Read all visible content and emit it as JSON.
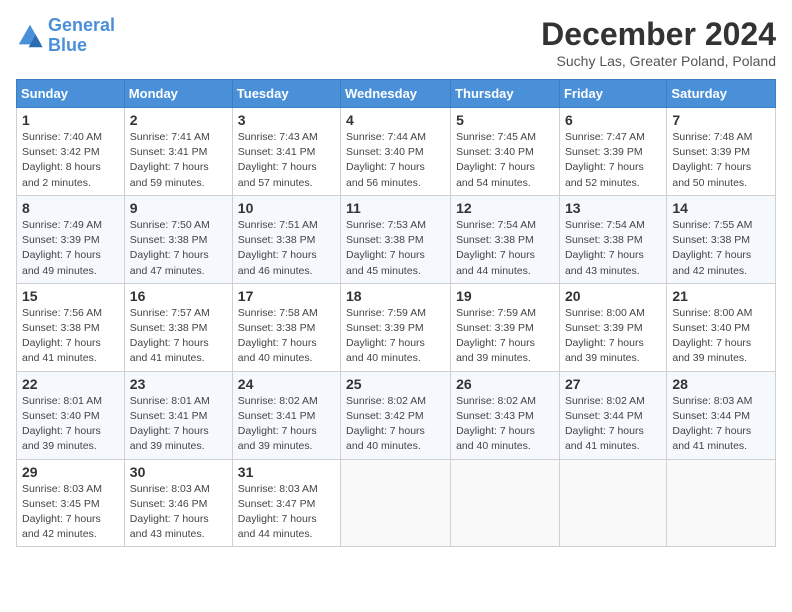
{
  "header": {
    "logo_line1": "General",
    "logo_line2": "Blue",
    "month_title": "December 2024",
    "location": "Suchy Las, Greater Poland, Poland"
  },
  "days_of_week": [
    "Sunday",
    "Monday",
    "Tuesday",
    "Wednesday",
    "Thursday",
    "Friday",
    "Saturday"
  ],
  "weeks": [
    [
      {
        "day": "1",
        "sunrise": "Sunrise: 7:40 AM",
        "sunset": "Sunset: 3:42 PM",
        "daylight": "Daylight: 8 hours and 2 minutes."
      },
      {
        "day": "2",
        "sunrise": "Sunrise: 7:41 AM",
        "sunset": "Sunset: 3:41 PM",
        "daylight": "Daylight: 7 hours and 59 minutes."
      },
      {
        "day": "3",
        "sunrise": "Sunrise: 7:43 AM",
        "sunset": "Sunset: 3:41 PM",
        "daylight": "Daylight: 7 hours and 57 minutes."
      },
      {
        "day": "4",
        "sunrise": "Sunrise: 7:44 AM",
        "sunset": "Sunset: 3:40 PM",
        "daylight": "Daylight: 7 hours and 56 minutes."
      },
      {
        "day": "5",
        "sunrise": "Sunrise: 7:45 AM",
        "sunset": "Sunset: 3:40 PM",
        "daylight": "Daylight: 7 hours and 54 minutes."
      },
      {
        "day": "6",
        "sunrise": "Sunrise: 7:47 AM",
        "sunset": "Sunset: 3:39 PM",
        "daylight": "Daylight: 7 hours and 52 minutes."
      },
      {
        "day": "7",
        "sunrise": "Sunrise: 7:48 AM",
        "sunset": "Sunset: 3:39 PM",
        "daylight": "Daylight: 7 hours and 50 minutes."
      }
    ],
    [
      {
        "day": "8",
        "sunrise": "Sunrise: 7:49 AM",
        "sunset": "Sunset: 3:39 PM",
        "daylight": "Daylight: 7 hours and 49 minutes."
      },
      {
        "day": "9",
        "sunrise": "Sunrise: 7:50 AM",
        "sunset": "Sunset: 3:38 PM",
        "daylight": "Daylight: 7 hours and 47 minutes."
      },
      {
        "day": "10",
        "sunrise": "Sunrise: 7:51 AM",
        "sunset": "Sunset: 3:38 PM",
        "daylight": "Daylight: 7 hours and 46 minutes."
      },
      {
        "day": "11",
        "sunrise": "Sunrise: 7:53 AM",
        "sunset": "Sunset: 3:38 PM",
        "daylight": "Daylight: 7 hours and 45 minutes."
      },
      {
        "day": "12",
        "sunrise": "Sunrise: 7:54 AM",
        "sunset": "Sunset: 3:38 PM",
        "daylight": "Daylight: 7 hours and 44 minutes."
      },
      {
        "day": "13",
        "sunrise": "Sunrise: 7:54 AM",
        "sunset": "Sunset: 3:38 PM",
        "daylight": "Daylight: 7 hours and 43 minutes."
      },
      {
        "day": "14",
        "sunrise": "Sunrise: 7:55 AM",
        "sunset": "Sunset: 3:38 PM",
        "daylight": "Daylight: 7 hours and 42 minutes."
      }
    ],
    [
      {
        "day": "15",
        "sunrise": "Sunrise: 7:56 AM",
        "sunset": "Sunset: 3:38 PM",
        "daylight": "Daylight: 7 hours and 41 minutes."
      },
      {
        "day": "16",
        "sunrise": "Sunrise: 7:57 AM",
        "sunset": "Sunset: 3:38 PM",
        "daylight": "Daylight: 7 hours and 41 minutes."
      },
      {
        "day": "17",
        "sunrise": "Sunrise: 7:58 AM",
        "sunset": "Sunset: 3:38 PM",
        "daylight": "Daylight: 7 hours and 40 minutes."
      },
      {
        "day": "18",
        "sunrise": "Sunrise: 7:59 AM",
        "sunset": "Sunset: 3:39 PM",
        "daylight": "Daylight: 7 hours and 40 minutes."
      },
      {
        "day": "19",
        "sunrise": "Sunrise: 7:59 AM",
        "sunset": "Sunset: 3:39 PM",
        "daylight": "Daylight: 7 hours and 39 minutes."
      },
      {
        "day": "20",
        "sunrise": "Sunrise: 8:00 AM",
        "sunset": "Sunset: 3:39 PM",
        "daylight": "Daylight: 7 hours and 39 minutes."
      },
      {
        "day": "21",
        "sunrise": "Sunrise: 8:00 AM",
        "sunset": "Sunset: 3:40 PM",
        "daylight": "Daylight: 7 hours and 39 minutes."
      }
    ],
    [
      {
        "day": "22",
        "sunrise": "Sunrise: 8:01 AM",
        "sunset": "Sunset: 3:40 PM",
        "daylight": "Daylight: 7 hours and 39 minutes."
      },
      {
        "day": "23",
        "sunrise": "Sunrise: 8:01 AM",
        "sunset": "Sunset: 3:41 PM",
        "daylight": "Daylight: 7 hours and 39 minutes."
      },
      {
        "day": "24",
        "sunrise": "Sunrise: 8:02 AM",
        "sunset": "Sunset: 3:41 PM",
        "daylight": "Daylight: 7 hours and 39 minutes."
      },
      {
        "day": "25",
        "sunrise": "Sunrise: 8:02 AM",
        "sunset": "Sunset: 3:42 PM",
        "daylight": "Daylight: 7 hours and 40 minutes."
      },
      {
        "day": "26",
        "sunrise": "Sunrise: 8:02 AM",
        "sunset": "Sunset: 3:43 PM",
        "daylight": "Daylight: 7 hours and 40 minutes."
      },
      {
        "day": "27",
        "sunrise": "Sunrise: 8:02 AM",
        "sunset": "Sunset: 3:44 PM",
        "daylight": "Daylight: 7 hours and 41 minutes."
      },
      {
        "day": "28",
        "sunrise": "Sunrise: 8:03 AM",
        "sunset": "Sunset: 3:44 PM",
        "daylight": "Daylight: 7 hours and 41 minutes."
      }
    ],
    [
      {
        "day": "29",
        "sunrise": "Sunrise: 8:03 AM",
        "sunset": "Sunset: 3:45 PM",
        "daylight": "Daylight: 7 hours and 42 minutes."
      },
      {
        "day": "30",
        "sunrise": "Sunrise: 8:03 AM",
        "sunset": "Sunset: 3:46 PM",
        "daylight": "Daylight: 7 hours and 43 minutes."
      },
      {
        "day": "31",
        "sunrise": "Sunrise: 8:03 AM",
        "sunset": "Sunset: 3:47 PM",
        "daylight": "Daylight: 7 hours and 44 minutes."
      },
      null,
      null,
      null,
      null
    ]
  ]
}
